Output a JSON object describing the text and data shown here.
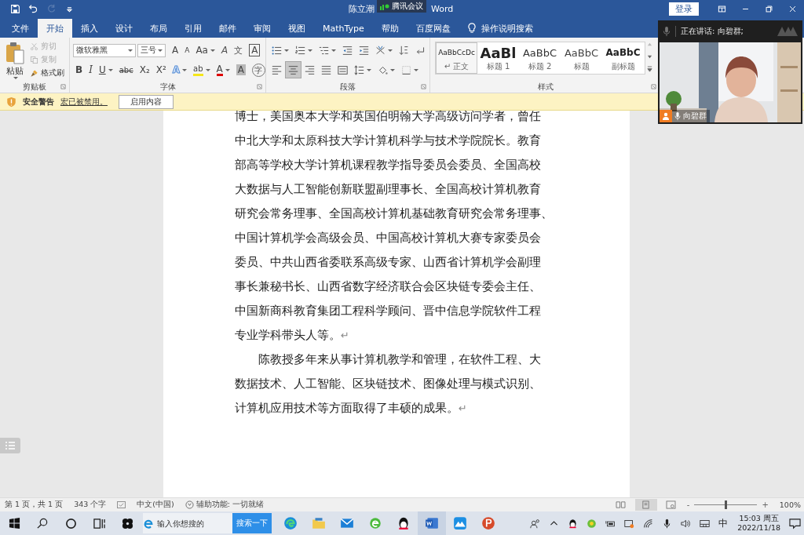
{
  "title_bar": {
    "quick_access": [
      {
        "kind": "save",
        "disabled": false
      },
      {
        "kind": "undo",
        "disabled": false
      },
      {
        "kind": "redo",
        "disabled": true
      },
      {
        "kind": "customize",
        "disabled": false
      }
    ],
    "title": "陈立潮",
    "title_suffix": "Word",
    "sign_in": "登录"
  },
  "meeting_badge": {
    "label": "腾讯会议"
  },
  "tabs": [
    {
      "label": "文件",
      "selected": false
    },
    {
      "label": "开始",
      "selected": true
    },
    {
      "label": "插入",
      "selected": false
    },
    {
      "label": "设计",
      "selected": false
    },
    {
      "label": "布局",
      "selected": false
    },
    {
      "label": "引用",
      "selected": false
    },
    {
      "label": "邮件",
      "selected": false
    },
    {
      "label": "审阅",
      "selected": false
    },
    {
      "label": "视图",
      "selected": false
    },
    {
      "label": "MathType",
      "selected": false
    },
    {
      "label": "帮助",
      "selected": false
    },
    {
      "label": "百度网盘",
      "selected": false
    }
  ],
  "tell_me": "操作说明搜索",
  "ribbon": {
    "clipboard": {
      "label": "剪贴板",
      "paste": "粘贴",
      "tools": [
        {
          "kind": "cut",
          "label": "剪切",
          "disabled": true
        },
        {
          "kind": "copy",
          "label": "复制",
          "disabled": true
        },
        {
          "kind": "brush",
          "label": "格式刷",
          "disabled": false
        }
      ]
    },
    "font": {
      "label": "字体",
      "font_name": "微软雅黑",
      "font_size": "三号",
      "row1": [
        {
          "text": "A",
          "kind": "grow",
          "caret": false
        },
        {
          "text": "A",
          "kind": "shrink",
          "caret": false
        },
        {
          "text": "Aa",
          "kind": "plain",
          "caret": true
        },
        {
          "text": "A",
          "kind": "clear",
          "caret": false
        },
        {
          "text": "文",
          "kind": "phonetic",
          "caret": false
        },
        {
          "text": "A",
          "kind": "boxed",
          "caret": false
        }
      ],
      "row2": [
        {
          "text": "B",
          "kind": "bold",
          "caret": false
        },
        {
          "text": "I",
          "kind": "italic",
          "caret": false
        },
        {
          "text": "U",
          "kind": "underline",
          "caret": true
        },
        {
          "text": "abc",
          "kind": "strike",
          "caret": false
        },
        {
          "text": "X₂",
          "kind": "plain",
          "caret": false
        },
        {
          "text": "X²",
          "kind": "plain",
          "caret": false
        },
        {
          "text": "A",
          "kind": "outline",
          "caret": true
        },
        {
          "text": "ab",
          "kind": "highlight",
          "caret": true
        },
        {
          "text": "A",
          "kind": "color",
          "caret": true
        },
        {
          "text": "A",
          "kind": "shaded",
          "caret": false
        },
        {
          "text": "字",
          "kind": "circle",
          "caret": false
        }
      ]
    },
    "paragraph": {
      "label": "段落",
      "row1": [
        {
          "kind": "bullets",
          "caret": true
        },
        {
          "kind": "numbering",
          "caret": true
        },
        {
          "kind": "multilevel",
          "caret": true
        },
        {
          "kind": "outdent",
          "caret": false
        },
        {
          "kind": "indent",
          "caret": false
        },
        {
          "kind": "asian",
          "caret": true
        },
        {
          "kind": "sort",
          "caret": false
        },
        {
          "kind": "marks",
          "caret": false
        }
      ],
      "row2": [
        {
          "kind": "align-left",
          "selected": false,
          "caret": false
        },
        {
          "kind": "align-center",
          "selected": true,
          "caret": false
        },
        {
          "kind": "align-right",
          "selected": false,
          "caret": false
        },
        {
          "kind": "justify",
          "selected": false,
          "caret": false
        },
        {
          "kind": "distribute",
          "selected": false,
          "caret": false
        },
        {
          "kind": "spacing",
          "selected": false,
          "caret": true
        },
        {
          "kind": "shading",
          "selected": false,
          "caret": true
        },
        {
          "kind": "borders",
          "selected": false,
          "caret": true
        }
      ]
    },
    "styles": {
      "label": "样式",
      "items": [
        {
          "preview": "AaBbCcDc",
          "label": "↵ 正文",
          "kind": "normal",
          "selected": true
        },
        {
          "preview": "AaBl",
          "label": "标题 1",
          "kind": "heading1",
          "selected": false
        },
        {
          "preview": "AaBbC",
          "label": "标题 2",
          "kind": "heading2",
          "selected": false
        },
        {
          "preview": "AaBbC",
          "label": "标题",
          "kind": "title",
          "selected": false
        },
        {
          "preview": "AaBbC",
          "label": "副标题",
          "kind": "subtitle",
          "selected": false
        }
      ]
    }
  },
  "security_bar": {
    "title": "安全警告",
    "message": "宏已被禁用。",
    "button": "启用内容"
  },
  "document": {
    "paragraphs": [
      {
        "end_mark": "↵",
        "lines": [
          "博士，美国奥本大学和英国伯明翰大学高级访问学者，曾任",
          "中北大学和太原科技大学计算机科学与技术学院院长。教育",
          "部高等学校大学计算机课程教学指导委员会委员、全国高校",
          "大数据与人工智能创新联盟副理事长、全国高校计算机教育",
          "研究会常务理事、全国高校计算机基础教育研究会常务理事、",
          "中国计算机学会高级会员、中国高校计算机大赛专家委员会",
          "委员、中共山西省委联系高级专家、山西省计算机学会副理",
          "事长兼秘书长、山西省数字经济联合会区块链专委会主任、",
          "中国新商科教育集团工程科学顾问、晋中信息学院软件工程",
          "专业学科带头人等。"
        ]
      },
      {
        "end_mark": "↵",
        "lines": [
          "　　陈教授多年来从事计算机教学和管理，在软件工程、大",
          "数据技术、人工智能、区块链技术、图像处理与模式识别、",
          "计算机应用技术等方面取得了丰硕的成果。"
        ]
      }
    ]
  },
  "status_bar": {
    "page": "第 1 页，共 1 页",
    "words": "343 个字",
    "language": "中文(中国)",
    "accessibility": "辅助功能: 一切就绪",
    "views": [
      {
        "kind": "read",
        "selected": false
      },
      {
        "kind": "print",
        "selected": true
      },
      {
        "kind": "web",
        "selected": false
      }
    ],
    "zoom_out": "-",
    "zoom_in": "+",
    "zoom": {
      "level": 0.5
    },
    "zoom_text": "100%"
  },
  "meeting_panel": {
    "speaking": "正在讲话: 向碧群;",
    "participant": "向碧群"
  },
  "taskbar": {
    "left": [
      {
        "kind": "start"
      },
      {
        "kind": "search"
      },
      {
        "kind": "cortana"
      },
      {
        "kind": "taskview"
      },
      {
        "kind": "pinwheel"
      }
    ],
    "search": {
      "placeholder": "输入你想搜的",
      "button": "搜索一下"
    },
    "apps": [
      {
        "kind": "edge",
        "selected": false
      },
      {
        "kind": "explorer",
        "selected": false
      },
      {
        "kind": "mail",
        "selected": false
      },
      {
        "kind": "ie",
        "selected": false
      },
      {
        "kind": "qq",
        "selected": false
      },
      {
        "kind": "word",
        "selected": true
      },
      {
        "kind": "feishu",
        "selected": false
      },
      {
        "kind": "powerpoint",
        "selected": false
      }
    ],
    "tray": [
      {
        "kind": "people"
      },
      {
        "kind": "chevron"
      },
      {
        "kind": "qq"
      },
      {
        "kind": "green"
      },
      {
        "kind": "battery"
      },
      {
        "kind": "camera"
      },
      {
        "kind": "wifi"
      },
      {
        "kind": "mic"
      },
      {
        "kind": "volume"
      },
      {
        "kind": "tablet"
      }
    ],
    "ime": "中",
    "time": "15:03 周五",
    "date": "2022/11/18"
  }
}
